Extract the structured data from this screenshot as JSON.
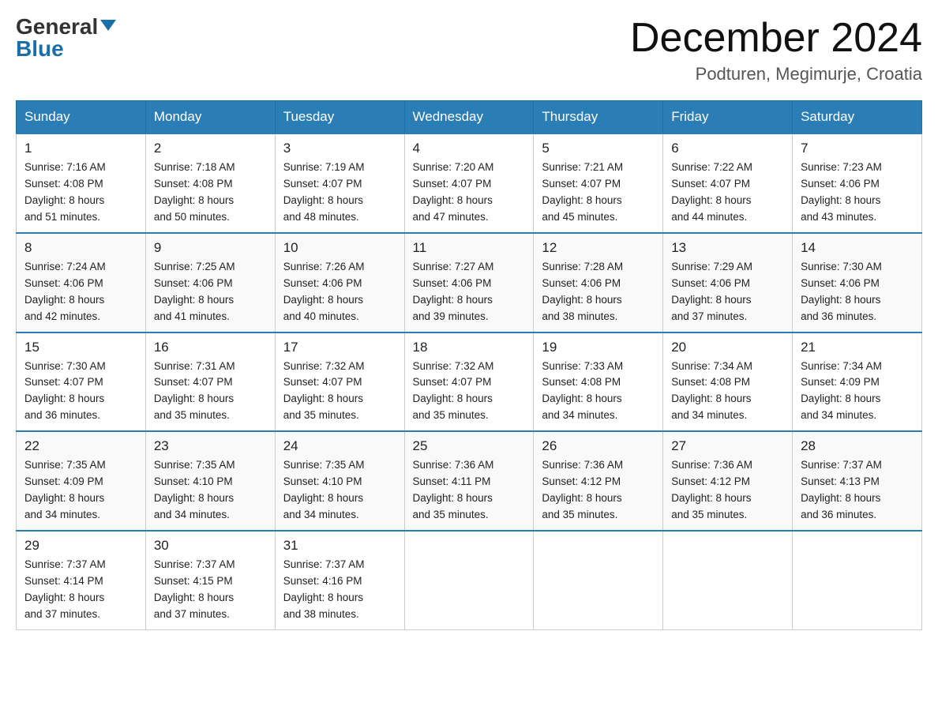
{
  "header": {
    "logo_general": "General",
    "logo_blue": "Blue",
    "month_title": "December 2024",
    "location": "Podturen, Megimurje, Croatia"
  },
  "weekdays": [
    "Sunday",
    "Monday",
    "Tuesday",
    "Wednesday",
    "Thursday",
    "Friday",
    "Saturday"
  ],
  "weeks": [
    [
      {
        "day": "1",
        "sunrise": "7:16 AM",
        "sunset": "4:08 PM",
        "daylight": "8 hours and 51 minutes."
      },
      {
        "day": "2",
        "sunrise": "7:18 AM",
        "sunset": "4:08 PM",
        "daylight": "8 hours and 50 minutes."
      },
      {
        "day": "3",
        "sunrise": "7:19 AM",
        "sunset": "4:07 PM",
        "daylight": "8 hours and 48 minutes."
      },
      {
        "day": "4",
        "sunrise": "7:20 AM",
        "sunset": "4:07 PM",
        "daylight": "8 hours and 47 minutes."
      },
      {
        "day": "5",
        "sunrise": "7:21 AM",
        "sunset": "4:07 PM",
        "daylight": "8 hours and 45 minutes."
      },
      {
        "day": "6",
        "sunrise": "7:22 AM",
        "sunset": "4:07 PM",
        "daylight": "8 hours and 44 minutes."
      },
      {
        "day": "7",
        "sunrise": "7:23 AM",
        "sunset": "4:06 PM",
        "daylight": "8 hours and 43 minutes."
      }
    ],
    [
      {
        "day": "8",
        "sunrise": "7:24 AM",
        "sunset": "4:06 PM",
        "daylight": "8 hours and 42 minutes."
      },
      {
        "day": "9",
        "sunrise": "7:25 AM",
        "sunset": "4:06 PM",
        "daylight": "8 hours and 41 minutes."
      },
      {
        "day": "10",
        "sunrise": "7:26 AM",
        "sunset": "4:06 PM",
        "daylight": "8 hours and 40 minutes."
      },
      {
        "day": "11",
        "sunrise": "7:27 AM",
        "sunset": "4:06 PM",
        "daylight": "8 hours and 39 minutes."
      },
      {
        "day": "12",
        "sunrise": "7:28 AM",
        "sunset": "4:06 PM",
        "daylight": "8 hours and 38 minutes."
      },
      {
        "day": "13",
        "sunrise": "7:29 AM",
        "sunset": "4:06 PM",
        "daylight": "8 hours and 37 minutes."
      },
      {
        "day": "14",
        "sunrise": "7:30 AM",
        "sunset": "4:06 PM",
        "daylight": "8 hours and 36 minutes."
      }
    ],
    [
      {
        "day": "15",
        "sunrise": "7:30 AM",
        "sunset": "4:07 PM",
        "daylight": "8 hours and 36 minutes."
      },
      {
        "day": "16",
        "sunrise": "7:31 AM",
        "sunset": "4:07 PM",
        "daylight": "8 hours and 35 minutes."
      },
      {
        "day": "17",
        "sunrise": "7:32 AM",
        "sunset": "4:07 PM",
        "daylight": "8 hours and 35 minutes."
      },
      {
        "day": "18",
        "sunrise": "7:32 AM",
        "sunset": "4:07 PM",
        "daylight": "8 hours and 35 minutes."
      },
      {
        "day": "19",
        "sunrise": "7:33 AM",
        "sunset": "4:08 PM",
        "daylight": "8 hours and 34 minutes."
      },
      {
        "day": "20",
        "sunrise": "7:34 AM",
        "sunset": "4:08 PM",
        "daylight": "8 hours and 34 minutes."
      },
      {
        "day": "21",
        "sunrise": "7:34 AM",
        "sunset": "4:09 PM",
        "daylight": "8 hours and 34 minutes."
      }
    ],
    [
      {
        "day": "22",
        "sunrise": "7:35 AM",
        "sunset": "4:09 PM",
        "daylight": "8 hours and 34 minutes."
      },
      {
        "day": "23",
        "sunrise": "7:35 AM",
        "sunset": "4:10 PM",
        "daylight": "8 hours and 34 minutes."
      },
      {
        "day": "24",
        "sunrise": "7:35 AM",
        "sunset": "4:10 PM",
        "daylight": "8 hours and 34 minutes."
      },
      {
        "day": "25",
        "sunrise": "7:36 AM",
        "sunset": "4:11 PM",
        "daylight": "8 hours and 35 minutes."
      },
      {
        "day": "26",
        "sunrise": "7:36 AM",
        "sunset": "4:12 PM",
        "daylight": "8 hours and 35 minutes."
      },
      {
        "day": "27",
        "sunrise": "7:36 AM",
        "sunset": "4:12 PM",
        "daylight": "8 hours and 35 minutes."
      },
      {
        "day": "28",
        "sunrise": "7:37 AM",
        "sunset": "4:13 PM",
        "daylight": "8 hours and 36 minutes."
      }
    ],
    [
      {
        "day": "29",
        "sunrise": "7:37 AM",
        "sunset": "4:14 PM",
        "daylight": "8 hours and 37 minutes."
      },
      {
        "day": "30",
        "sunrise": "7:37 AM",
        "sunset": "4:15 PM",
        "daylight": "8 hours and 37 minutes."
      },
      {
        "day": "31",
        "sunrise": "7:37 AM",
        "sunset": "4:16 PM",
        "daylight": "8 hours and 38 minutes."
      },
      null,
      null,
      null,
      null
    ]
  ],
  "labels": {
    "sunrise": "Sunrise:",
    "sunset": "Sunset:",
    "daylight": "Daylight:"
  }
}
